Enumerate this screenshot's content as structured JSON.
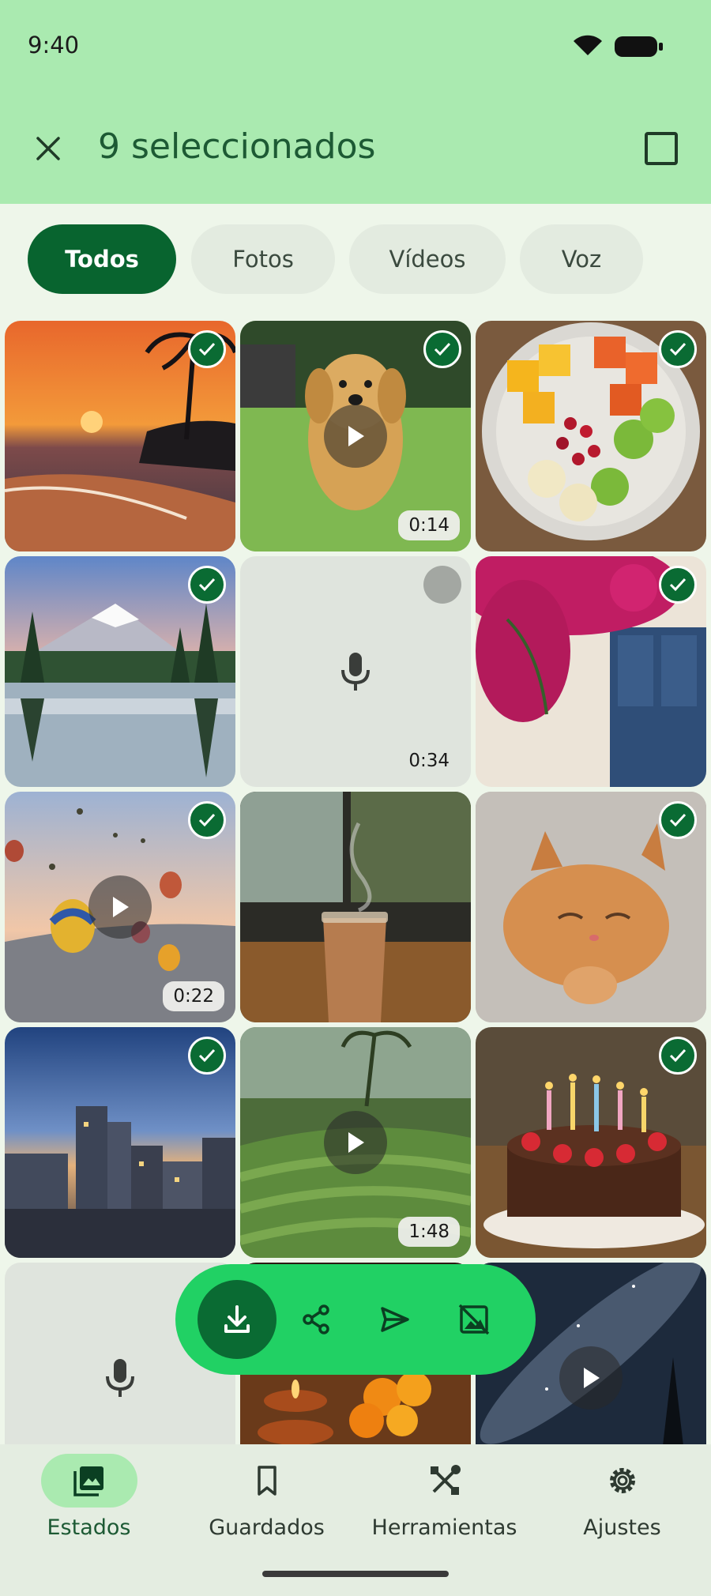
{
  "status": {
    "time": "9:40"
  },
  "header": {
    "title": "9 seleccionados"
  },
  "filters": [
    "Todos",
    "Fotos",
    "Vídeos",
    "Voz"
  ],
  "tiles": [
    {
      "kind": "photo",
      "scene": "sunset-beach",
      "selected": true
    },
    {
      "kind": "video",
      "scene": "puppy",
      "selected": true,
      "duration": "0:14"
    },
    {
      "kind": "photo",
      "scene": "fruit-bowl",
      "selected": true
    },
    {
      "kind": "photo",
      "scene": "mountain-lake",
      "selected": true
    },
    {
      "kind": "voice",
      "selected": false,
      "duration": "0:34"
    },
    {
      "kind": "photo",
      "scene": "flower-door",
      "selected": true
    },
    {
      "kind": "video",
      "scene": "hot-air-balloons",
      "selected": true,
      "duration": "0:22"
    },
    {
      "kind": "photo",
      "scene": "iced-coffee",
      "selected": false
    },
    {
      "kind": "photo",
      "scene": "sleeping-kitten",
      "selected": true
    },
    {
      "kind": "photo",
      "scene": "city-dusk",
      "selected": true
    },
    {
      "kind": "video",
      "scene": "rice-terraces",
      "selected": false,
      "duration": "1:48"
    },
    {
      "kind": "photo",
      "scene": "birthday-cake",
      "selected": true
    },
    {
      "kind": "voice",
      "selected": false
    },
    {
      "kind": "photo",
      "scene": "candles-marigolds",
      "selected": false
    },
    {
      "kind": "video",
      "scene": "milky-way",
      "selected": false
    }
  ],
  "actions": [
    "download-icon",
    "share-icon",
    "send-icon",
    "hide-image-icon"
  ],
  "nav": [
    {
      "label": "Estados",
      "icon": "gallery-icon",
      "active": true
    },
    {
      "label": "Guardados",
      "icon": "bookmark-icon"
    },
    {
      "label": "Herramientas",
      "icon": "tools-icon"
    },
    {
      "label": "Ajustes",
      "icon": "gear-icon"
    }
  ],
  "colors": {
    "header": "#aaeab0",
    "accent": "#0a6b33",
    "actionbar": "#21d164"
  }
}
